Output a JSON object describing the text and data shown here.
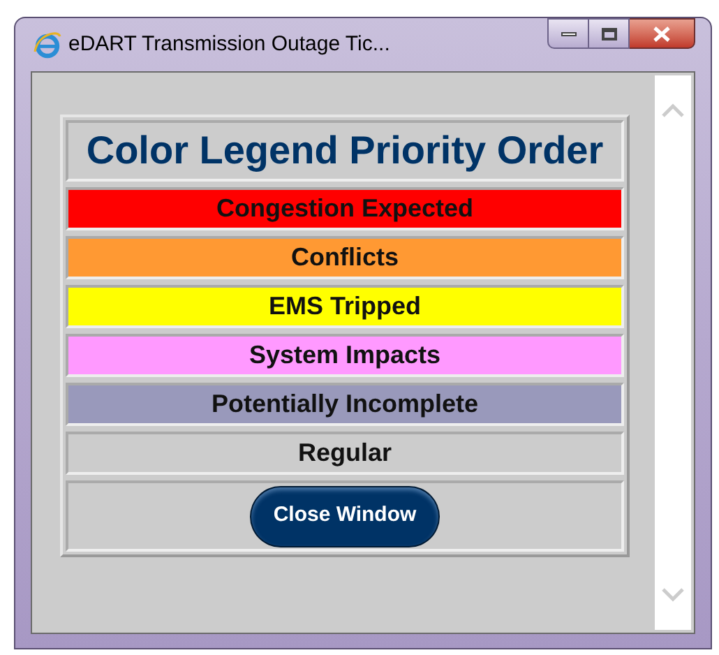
{
  "window": {
    "title": "eDART Transmission Outage Tic..."
  },
  "legend": {
    "title": "Color Legend Priority Order",
    "items": [
      {
        "label": "Congestion Expected",
        "color": "#ff0000"
      },
      {
        "label": "Conflicts",
        "color": "#ff9933"
      },
      {
        "label": "EMS Tripped",
        "color": "#ffff00"
      },
      {
        "label": "System Impacts",
        "color": "#ff99ff"
      },
      {
        "label": "Potentially Incomplete",
        "color": "#9999bb"
      },
      {
        "label": "Regular",
        "color": "#cccccc"
      }
    ]
  },
  "button": "Close Window"
}
